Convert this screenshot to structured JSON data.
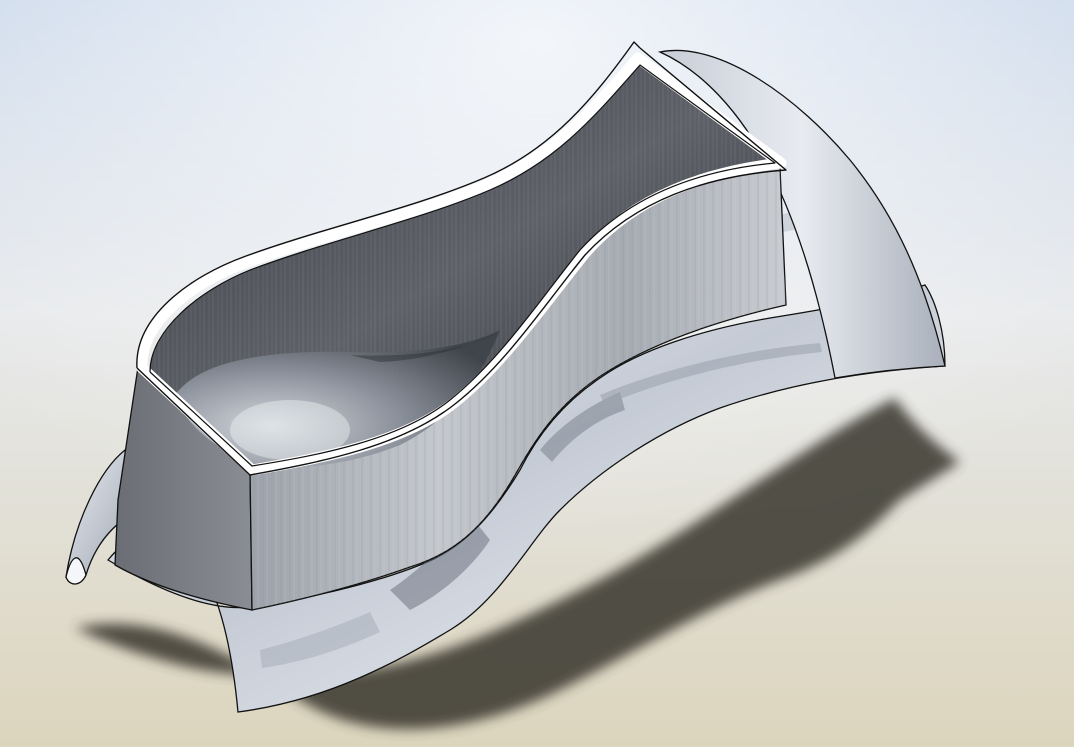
{
  "scene": {
    "subject": "curved-sheet-metal-part",
    "colors": {
      "background_top": "#c9d7ea",
      "background_mid": "#e7e9eb",
      "background_bottom": "#dcd5bd",
      "shadow": "#3e3b33",
      "wall_inner": "#54575d",
      "wall_outer": "#b3b7bd",
      "rim": "#ffffff",
      "outline": "#111111",
      "base_chrome": "#d5dae2"
    }
  }
}
